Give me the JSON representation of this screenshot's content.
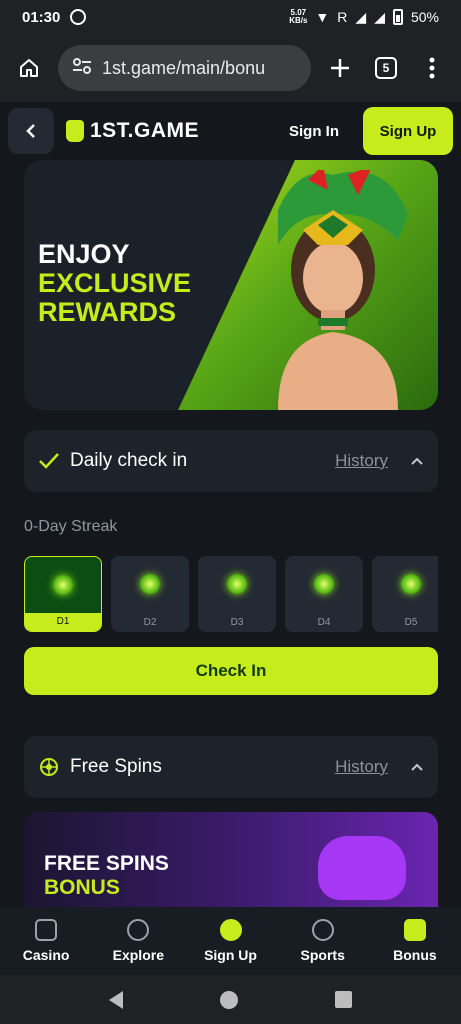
{
  "status": {
    "time": "01:30",
    "net_speed": "5.07",
    "net_unit": "KB/s",
    "roaming": "R",
    "battery": "50%"
  },
  "browser": {
    "url": "1st.game/main/bonu",
    "tab_count": "5"
  },
  "header": {
    "logo": "1ST.GAME",
    "signin": "Sign In",
    "signup": "Sign Up"
  },
  "hero": {
    "line1": "ENJOY",
    "line2": "EXCLUSIVE",
    "line3": "REWARDS"
  },
  "daily": {
    "title": "Daily check in",
    "history": "History",
    "streak": "0-Day Streak",
    "days": [
      "D1",
      "D2",
      "D3",
      "D4",
      "D5"
    ],
    "button": "Check In"
  },
  "spins": {
    "title": "Free Spins",
    "history": "History",
    "banner_line1": "FREE SPINS",
    "banner_line2": "BONUS"
  },
  "nav": {
    "casino": "Casino",
    "explore": "Explore",
    "signup": "Sign Up",
    "sports": "Sports",
    "bonus": "Bonus"
  },
  "colors": {
    "accent": "#c6ec1c",
    "bg": "#14181d",
    "card": "#1d232b"
  }
}
